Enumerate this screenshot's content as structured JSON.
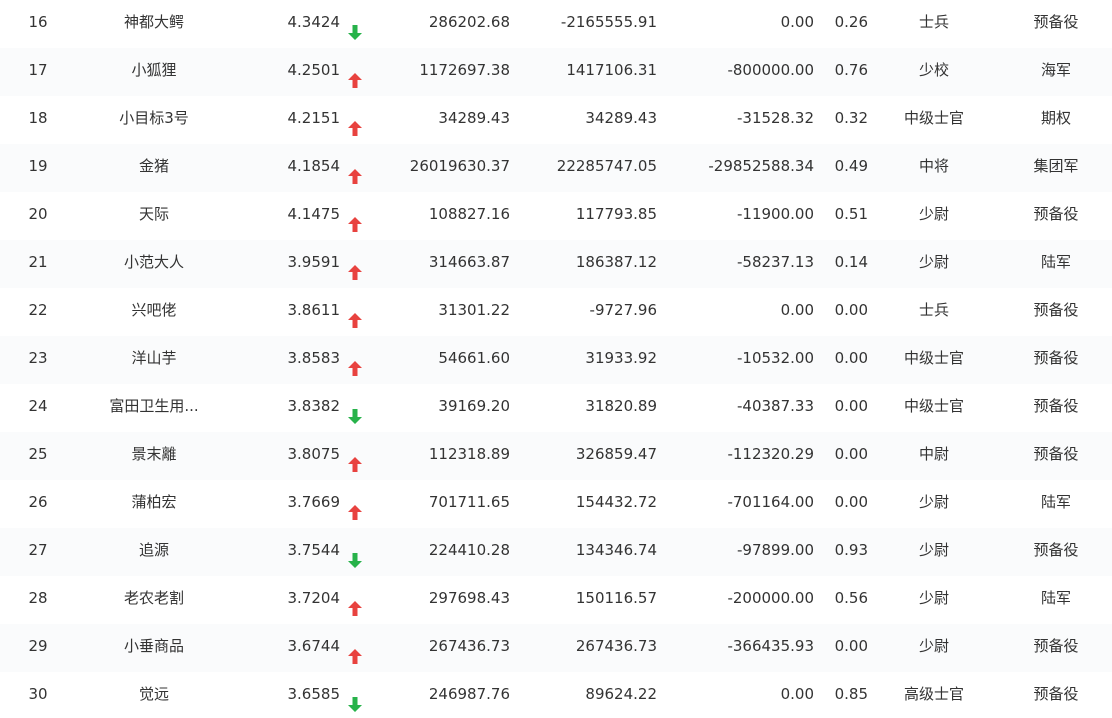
{
  "colors": {
    "up": "#e8423f",
    "down": "#27b24a",
    "text": "#333333"
  },
  "rows": [
    {
      "rank": "16",
      "name": "神都大鳄",
      "score": "4.3424",
      "trend": "down",
      "v1": "286202.68",
      "v2": "-2165555.91",
      "v3": "0.00",
      "ratio": "0.26",
      "level": "士兵",
      "category": "预备役"
    },
    {
      "rank": "17",
      "name": "小狐狸",
      "score": "4.2501",
      "trend": "up",
      "v1": "1172697.38",
      "v2": "1417106.31",
      "v3": "-800000.00",
      "ratio": "0.76",
      "level": "少校",
      "category": "海军"
    },
    {
      "rank": "18",
      "name": "小目标3号",
      "score": "4.2151",
      "trend": "up",
      "v1": "34289.43",
      "v2": "34289.43",
      "v3": "-31528.32",
      "ratio": "0.32",
      "level": "中级士官",
      "category": "期权"
    },
    {
      "rank": "19",
      "name": "金猪",
      "score": "4.1854",
      "trend": "up",
      "v1": "26019630.37",
      "v2": "22285747.05",
      "v3": "-29852588.34",
      "ratio": "0.49",
      "level": "中将",
      "category": "集团军"
    },
    {
      "rank": "20",
      "name": "天际",
      "score": "4.1475",
      "trend": "up",
      "v1": "108827.16",
      "v2": "117793.85",
      "v3": "-11900.00",
      "ratio": "0.51",
      "level": "少尉",
      "category": "预备役"
    },
    {
      "rank": "21",
      "name": "小范大人",
      "score": "3.9591",
      "trend": "up",
      "v1": "314663.87",
      "v2": "186387.12",
      "v3": "-58237.13",
      "ratio": "0.14",
      "level": "少尉",
      "category": "陆军"
    },
    {
      "rank": "22",
      "name": "兴吧佬",
      "score": "3.8611",
      "trend": "up",
      "v1": "31301.22",
      "v2": "-9727.96",
      "v3": "0.00",
      "ratio": "0.00",
      "level": "士兵",
      "category": "预备役"
    },
    {
      "rank": "23",
      "name": "洋山芋",
      "score": "3.8583",
      "trend": "up",
      "v1": "54661.60",
      "v2": "31933.92",
      "v3": "-10532.00",
      "ratio": "0.00",
      "level": "中级士官",
      "category": "预备役"
    },
    {
      "rank": "24",
      "name": "富田卫生用...",
      "score": "3.8382",
      "trend": "down",
      "v1": "39169.20",
      "v2": "31820.89",
      "v3": "-40387.33",
      "ratio": "0.00",
      "level": "中级士官",
      "category": "预备役"
    },
    {
      "rank": "25",
      "name": "景末離",
      "score": "3.8075",
      "trend": "up",
      "v1": "112318.89",
      "v2": "326859.47",
      "v3": "-112320.29",
      "ratio": "0.00",
      "level": "中尉",
      "category": "预备役"
    },
    {
      "rank": "26",
      "name": "蒲柏宏",
      "score": "3.7669",
      "trend": "up",
      "v1": "701711.65",
      "v2": "154432.72",
      "v3": "-701164.00",
      "ratio": "0.00",
      "level": "少尉",
      "category": "陆军"
    },
    {
      "rank": "27",
      "name": "追源",
      "score": "3.7544",
      "trend": "down",
      "v1": "224410.28",
      "v2": "134346.74",
      "v3": "-97899.00",
      "ratio": "0.93",
      "level": "少尉",
      "category": "预备役"
    },
    {
      "rank": "28",
      "name": "老农老割",
      "score": "3.7204",
      "trend": "up",
      "v1": "297698.43",
      "v2": "150116.57",
      "v3": "-200000.00",
      "ratio": "0.56",
      "level": "少尉",
      "category": "陆军"
    },
    {
      "rank": "29",
      "name": "小垂商品",
      "score": "3.6744",
      "trend": "up",
      "v1": "267436.73",
      "v2": "267436.73",
      "v3": "-366435.93",
      "ratio": "0.00",
      "level": "少尉",
      "category": "预备役"
    },
    {
      "rank": "30",
      "name": "觉远",
      "score": "3.6585",
      "trend": "down",
      "v1": "246987.76",
      "v2": "89624.22",
      "v3": "0.00",
      "ratio": "0.85",
      "level": "高级士官",
      "category": "预备役"
    }
  ]
}
